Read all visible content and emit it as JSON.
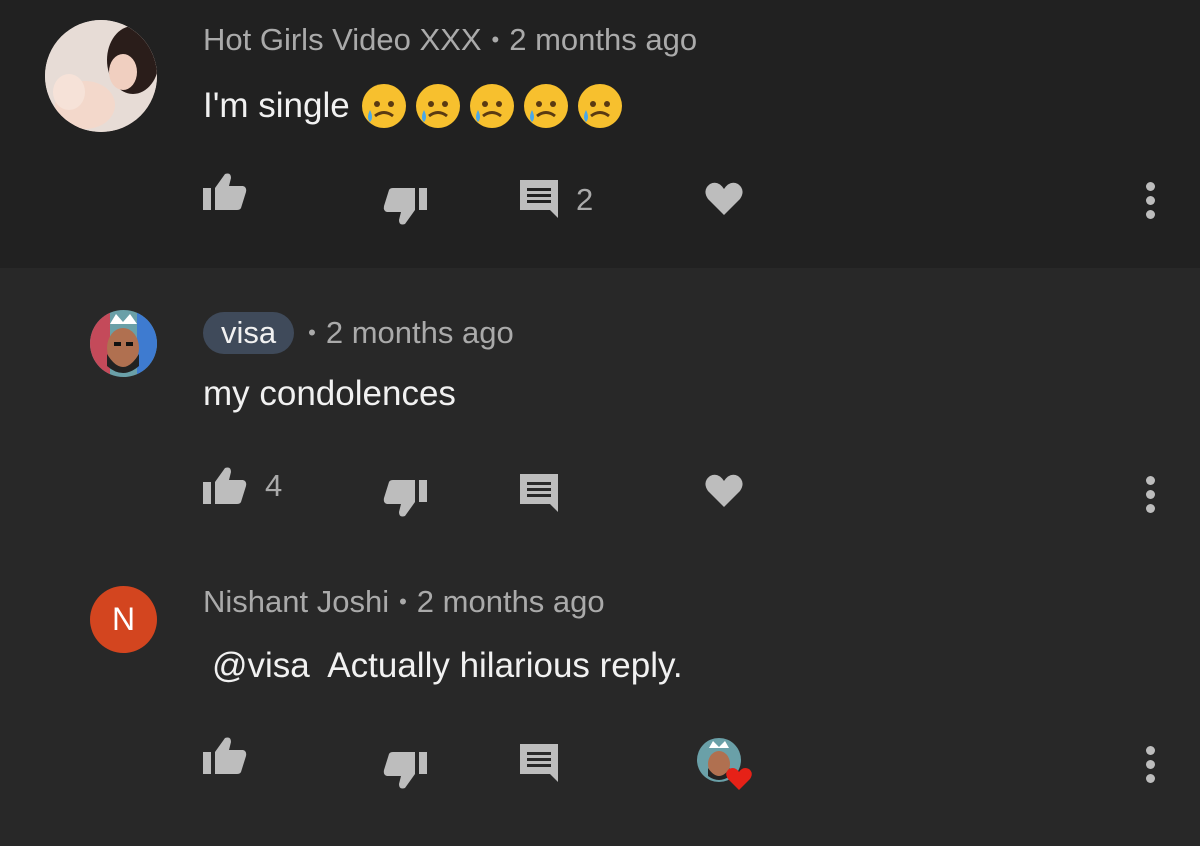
{
  "comments": [
    {
      "author": "Hot Girls Video XXX",
      "time": "2 months ago",
      "text": "I'm single",
      "emojis": [
        "sad-but-relieved-face",
        "sad-but-relieved-face",
        "sad-but-relieved-face",
        "sad-but-relieved-face",
        "sad-but-relieved-face"
      ],
      "likes": "",
      "replies": "2",
      "hearted": false
    },
    {
      "author": "visa",
      "author_is_creator": true,
      "time": "2 months ago",
      "text": "my condolences",
      "likes": "4",
      "replies": "",
      "hearted": false
    },
    {
      "author": "Nishant Joshi",
      "avatar_letter": "N",
      "avatar_color": "#d3451f",
      "time": "2 months ago",
      "text": "@visa  Actually hilarious reply.",
      "likes": "",
      "replies": "",
      "hearted": true
    }
  ],
  "colors": {
    "background": "#232323",
    "chip": "#3f4a5a",
    "icon": "#bdbdbd",
    "heart_badge": "#e62117"
  },
  "icons": [
    "thumb-up-icon",
    "thumb-down-icon",
    "reply-icon",
    "heart-icon",
    "more-vert-icon"
  ]
}
